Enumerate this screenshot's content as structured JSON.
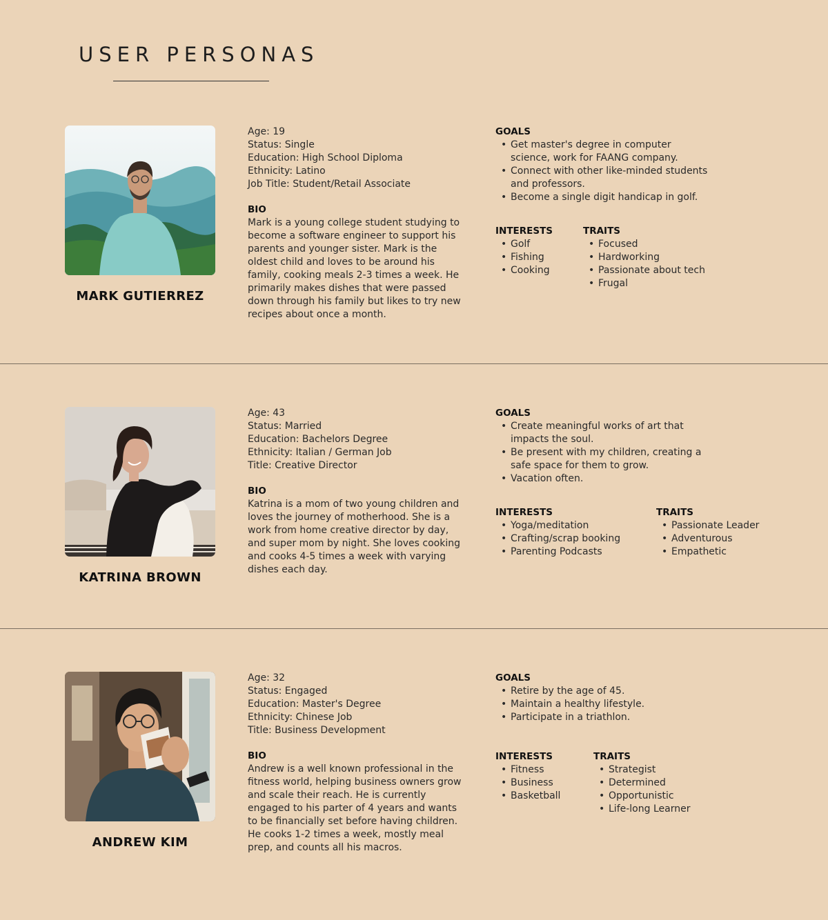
{
  "page": {
    "title": "USER PERSONAS"
  },
  "personas": [
    {
      "name": "MARK GUTIERREZ",
      "details": [
        "Age: 19",
        "Status: Single",
        "Education: High School Diploma",
        "Ethnicity: Latino",
        "Job Title: Student/Retail Associate"
      ],
      "bio_label": "BIO",
      "bio_lines": [
        "Mark is a young college student studying to",
        "become a software engineer to support his",
        "parents and younger sister. Mark is the",
        "oldest child and loves to be around his",
        "family, cooking meals 2-3 times a week. He",
        "primarily makes dishes that were passed",
        "down through his family but likes to try new",
        "recipes about once a month."
      ],
      "goals_label": "GOALS",
      "goals": [
        "Get master's degree in computer\nscience, work for FAANG company.",
        "Connect with other like-minded students\nand professors.",
        "Become a single digit handicap in golf."
      ],
      "interests_label": "INTERESTS",
      "interests": [
        "Golf",
        "Fishing",
        "Cooking"
      ],
      "traits_label": "TRAITS",
      "traits": [
        "Focused",
        "Hardworking",
        "Passionate about tech",
        "Frugal"
      ]
    },
    {
      "name": "KATRINA BROWN",
      "details": [
        "Age: 43",
        "Status: Married",
        "Education: Bachelors Degree",
        "Ethnicity: Italian / German Job",
        "Title: Creative Director"
      ],
      "bio_label": "BIO",
      "bio_lines": [
        "Katrina is a mom of two young children and",
        "loves the journey of motherhood. She is a",
        "work from home creative director by day,",
        "and super mom by night. She loves cooking",
        "and cooks 4-5 times a week with varying",
        "dishes each day."
      ],
      "goals_label": "GOALS",
      "goals": [
        "Create meaningful works of art that\nimpacts the soul.",
        "Be present with my children, creating a\nsafe space for them to grow.",
        "Vacation often."
      ],
      "interests_label": "INTERESTS",
      "interests": [
        "Yoga/meditation",
        "Crafting/scrap booking",
        "Parenting Podcasts"
      ],
      "traits_label": "TRAITS",
      "traits": [
        "Passionate Leader",
        "Adventurous",
        "Empathetic"
      ]
    },
    {
      "name": "ANDREW KIM",
      "details": [
        "Age: 32",
        "Status: Engaged",
        "Education: Master's Degree",
        "Ethnicity: Chinese Job",
        "Title: Business Development"
      ],
      "bio_label": "BIO",
      "bio_lines": [
        "Andrew is a well known professional in the",
        "fitness world, helping business owners grow",
        "and scale their reach. He is currently",
        "engaged to his parter of 4 years and wants",
        "to be financially set before having children.",
        "He cooks 1-2 times a week, mostly meal",
        "prep, and counts all his macros."
      ],
      "goals_label": "GOALS",
      "goals": [
        "Retire by the age of 45.",
        "Maintain a healthy lifestyle.",
        "Participate in a triathlon."
      ],
      "interests_label": "INTERESTS",
      "interests": [
        "Fitness",
        "Business",
        "Basketball"
      ],
      "traits_label": "TRAITS",
      "traits": [
        "Strategist",
        "Determined",
        "Opportunistic",
        "Life-long Learner"
      ]
    }
  ]
}
